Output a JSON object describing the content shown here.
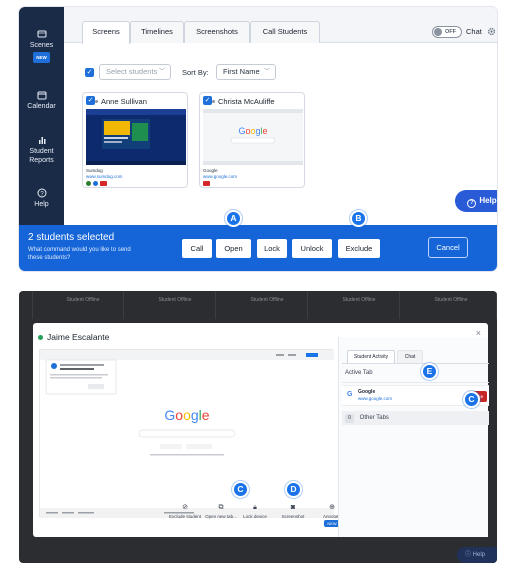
{
  "panel1": {
    "sidebar": {
      "items": [
        {
          "label": "Scenes",
          "icon": "scenes-icon",
          "badge": "NEW"
        },
        {
          "label": "Calendar",
          "icon": "calendar-icon"
        },
        {
          "label": "Student Reports",
          "icon": "reports-icon"
        },
        {
          "label": "Help",
          "icon": "help-circle-icon"
        }
      ]
    },
    "tabs": [
      "Screens",
      "Timelines",
      "Screenshots",
      "Call Students"
    ],
    "chat_toggle": {
      "state": "OFF",
      "label": "Chat"
    },
    "filters": {
      "select_placeholder": "Select students",
      "sort_label": "Sort By:",
      "sort_value": "First Name"
    },
    "cards": [
      {
        "name": "Anne Sullivan",
        "caption": "Sumdog",
        "url": "www.sumdog.com"
      },
      {
        "name": "Christa McAuliffe",
        "caption": "Google",
        "url": "www.google.com"
      }
    ],
    "help_button": "Help",
    "action_bar": {
      "title": "2 students selected",
      "subtitle": "What command would you like to send these students?",
      "buttons": [
        "Call",
        "Open",
        "Lock",
        "Unlock",
        "Exclude"
      ],
      "cancel": "Cancel"
    },
    "markers": {
      "open": "A",
      "exclude": "B"
    }
  },
  "panel2": {
    "offline_label": "Student Offline",
    "modal": {
      "student_name": "Jaime Escalante",
      "close": "×",
      "screen_brand": "Google",
      "toolbar": [
        {
          "label": "Exclude student",
          "icon": "exclude-icon"
        },
        {
          "label": "Open new tab...",
          "icon": "new-tab-icon"
        },
        {
          "label": "Lock device",
          "icon": "lock-icon"
        },
        {
          "label": "Screenshot",
          "icon": "camera-icon"
        },
        {
          "label": "Annotate",
          "icon": "annotate-icon",
          "badge": "NEW"
        }
      ],
      "side_panel": {
        "tabs": [
          "Student Activity",
          "Chat"
        ],
        "active_tab_heading": "Active Tab",
        "active_site": {
          "title": "Google",
          "url": "www.google.com",
          "close_label": "Close"
        },
        "other_tabs": "Other Tabs",
        "other_tabs_count": "0"
      }
    },
    "markers": {
      "close": "C",
      "lock": "C",
      "annotate": "D",
      "chat": "E"
    },
    "help_button": "Help"
  },
  "colors": {
    "brand_blue": "#1565d8",
    "sidebar_navy": "#1a2b47",
    "danger": "#c62828"
  }
}
